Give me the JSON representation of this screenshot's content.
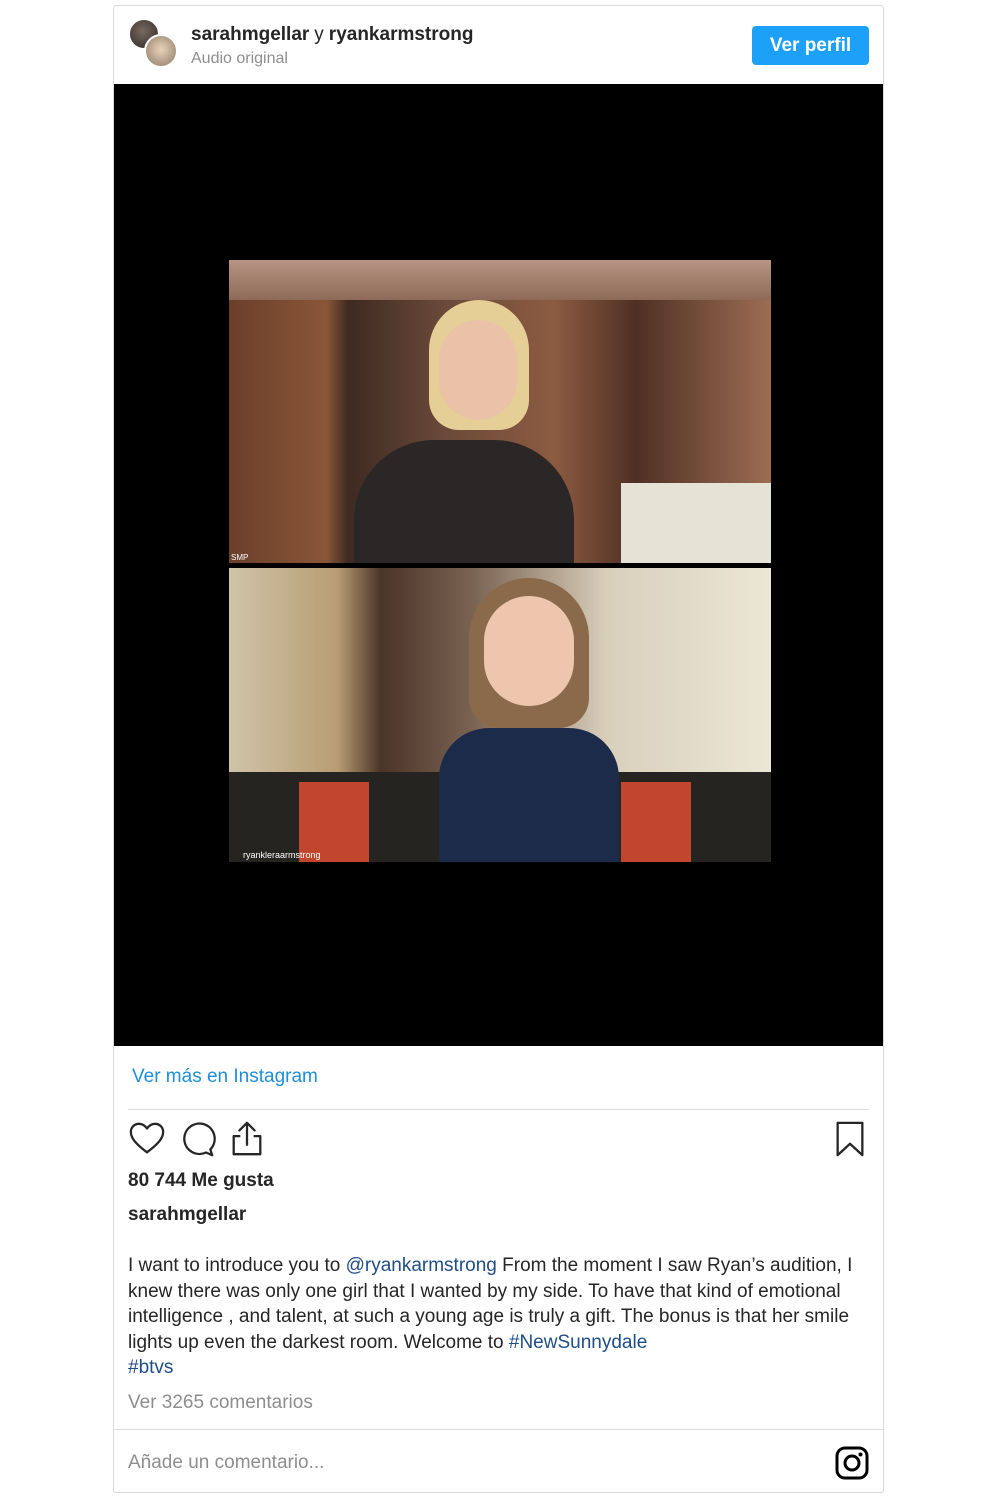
{
  "header": {
    "user1": "sarahmgellar",
    "separator": "y",
    "user2": "ryankarmstrong",
    "subtitle": "Audio original",
    "profile_button": "Ver perfil"
  },
  "video": {
    "top_tag": "SMP",
    "bottom_tag": "ryankleraarmstrong"
  },
  "more_link": "Ver más en Instagram",
  "likes": "80 744 Me gusta",
  "author": "sarahmgellar",
  "caption": {
    "part1": "I want to introduce you to ",
    "mention": "@ryankarmstrong",
    "part2": " From the moment I saw Ryan’s audition, I knew there was only one girl that I wanted by my side. To have that kind of emotional intelligence , and talent, at such a young age is truly a gift. The bonus is that her smile lights up even the darkest room. Welcome to ",
    "hashtag1": "#NewSunnydale",
    "hashtag2": "#btvs"
  },
  "comments_link": "Ver 3265 comentarios",
  "comment_placeholder": "Añade un comentario...",
  "icons": {
    "like": "heart-icon",
    "comment": "comment-icon",
    "share": "share-icon",
    "save": "bookmark-icon",
    "brand": "instagram-icon"
  }
}
